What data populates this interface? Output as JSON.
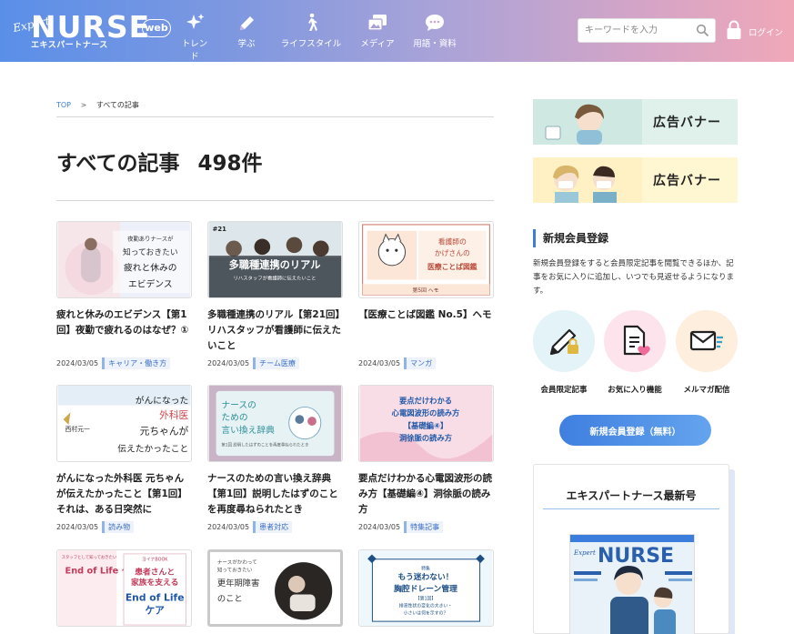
{
  "header": {
    "logo": {
      "expert": "Expert",
      "name": "NURSE",
      "web": "web",
      "kana": "エキスパートナース"
    },
    "nav": [
      {
        "label": "トレンド",
        "icon": "sparkle-icon"
      },
      {
        "label": "学ぶ",
        "icon": "pencil-icon"
      },
      {
        "label": "ライフスタイル",
        "icon": "walking-person-icon"
      },
      {
        "label": "メディア",
        "icon": "media-images-icon"
      },
      {
        "label": "用語・資料",
        "icon": "speech-bubble-icon"
      }
    ],
    "search": {
      "placeholder": "キーワードを入力",
      "value": ""
    },
    "login_label": "ログイン"
  },
  "breadcrumb": {
    "top": "TOP",
    "separator": ">",
    "current": "すべての記事"
  },
  "page_title": "すべての記事",
  "article_count": "498件",
  "articles": [
    {
      "title": "疲れと休みのエビデンス【第1回】夜勤で疲れるのはなぜ？①",
      "date": "2024/03/05",
      "tag": "キャリア・働き方",
      "thumb": {
        "lines": [
          "夜勤ありナースが",
          "知っておきたい",
          "疲れと休みの",
          "エビデンス"
        ]
      }
    },
    {
      "title": "多職種連携のリアル【第21回】リハスタッフが看護師に伝えたいこと",
      "date": "2024/03/05",
      "tag": "チーム医療",
      "thumb": {
        "badge": "#21",
        "heading": "多職種連携のリアル",
        "sub": "リハスタッフが看護師に伝えたいこと"
      }
    },
    {
      "title": "【医療ことば図鑑 No.5】ヘモ",
      "date": "2024/03/05",
      "tag": "マンガ",
      "thumb": {
        "lines": [
          "看護師の",
          "かげさんの",
          "医療ことば図鑑"
        ],
        "footer": "第5回 ヘモ"
      }
    },
    {
      "title": "がんになった外科医 元ちゃんが伝えたかったこと【第1回】それは、ある日突然に",
      "date": "2024/03/05",
      "tag": "読み物",
      "thumb": {
        "lines": [
          "がんになった",
          "外科医",
          "元ちゃんが",
          "伝えたかったこと"
        ],
        "author": "西村元一"
      }
    },
    {
      "title": "ナースのための言い換え辞典【第1回】説明したはずのことを再度尋ねられたとき",
      "date": "2024/03/05",
      "tag": "患者対応",
      "thumb": {
        "lines": [
          "ナースの",
          "ための",
          "言い換え辞典"
        ],
        "sub": "第1回 説明したはずのことを再度尋ねられたとき"
      }
    },
    {
      "title": "要点だけわかる心電図波形の読み方【基礎編④】洞徐脈の読み方",
      "date": "2024/03/05",
      "tag": "特集記事",
      "thumb": {
        "lines": [
          "要点だけわかる",
          "心電図波形の読み方",
          "【基礎編④】",
          "洞徐脈の読み方"
        ]
      }
    },
    {
      "title": "",
      "date": "",
      "tag": "",
      "thumb": {
        "top": "スタッフとして知っておきたい",
        "heading": "End of Life ケア",
        "right_top": "ヨイナBOOK",
        "right_lines": [
          "患者さんと",
          "家族を支える",
          "End of Life",
          "ケア"
        ]
      }
    },
    {
      "title": "",
      "date": "",
      "tag": "",
      "thumb": {
        "lines": [
          "ナースがかわって",
          "知っておきたい",
          "更年期障害",
          "のこと"
        ]
      }
    },
    {
      "title": "",
      "date": "",
      "tag": "",
      "thumb": {
        "label": "特集",
        "lines": [
          "もう迷わない！",
          "胸腔ドレーン管理"
        ],
        "sub": [
          "【第1回】",
          "排液性状の変化の大きい・",
          "小さいは何を示すの？"
        ]
      }
    }
  ],
  "sidebar": {
    "banners": [
      {
        "label": "広告バナー",
        "bg": "#dff1ea"
      },
      {
        "label": "広告バナー",
        "bg": "#fff6d2"
      }
    ],
    "signup": {
      "heading": "新規会員登録",
      "description": "新規会員登録をすると会員限定記事を閲覧できるほか、記事をお気に入りに追加し、いつでも見返せるようになります。",
      "features": [
        {
          "label": "会員限定記事",
          "icon": "pen-lock-icon",
          "bg": "#e3f3f7"
        },
        {
          "label": "お気に入り機能",
          "icon": "document-heart-icon",
          "bg": "#fde3ec"
        },
        {
          "label": "メルマガ配信",
          "icon": "mail-icon",
          "bg": "#fdeede"
        }
      ],
      "button_label": "新規会員登録（無料）"
    },
    "magazine": {
      "heading": "エキスパートナース最新号",
      "cover_name": "NURSE",
      "cover_expert": "Expert"
    }
  },
  "colors": {
    "accent": "#3b7ddd",
    "tag_bg": "#eef3fb",
    "tag_border": "#8fb4e8"
  }
}
